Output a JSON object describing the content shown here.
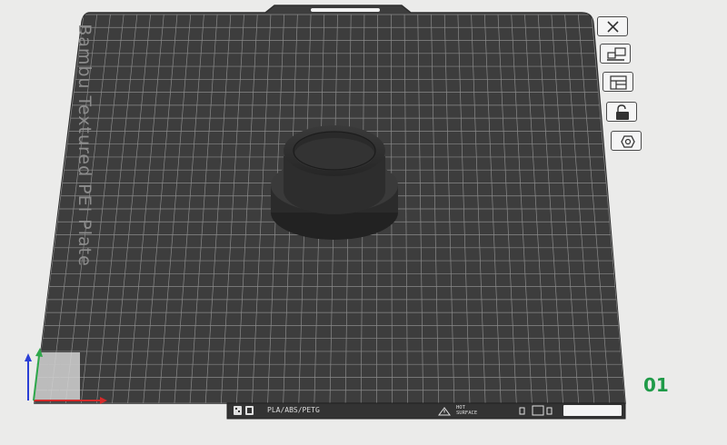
{
  "plate": {
    "name": "Bambu Textured PEI Plate",
    "number": "01"
  },
  "bottom_strip": {
    "materials": "PLA/ABS/PETG",
    "warning_line1": "HOT",
    "warning_line2": "SURFACE"
  },
  "toolbar": {
    "close_icon": "close-icon",
    "arrange_icon": "arrange-icon",
    "layout_icon": "layout-icon",
    "lock_icon": "lock-icon",
    "settings_icon": "hexagon-settings-icon"
  },
  "colors": {
    "plate": "#3d3d3d",
    "grid": "#8a8a8a",
    "model": "#2f2f2f",
    "plate_number": "#1f9a48"
  }
}
